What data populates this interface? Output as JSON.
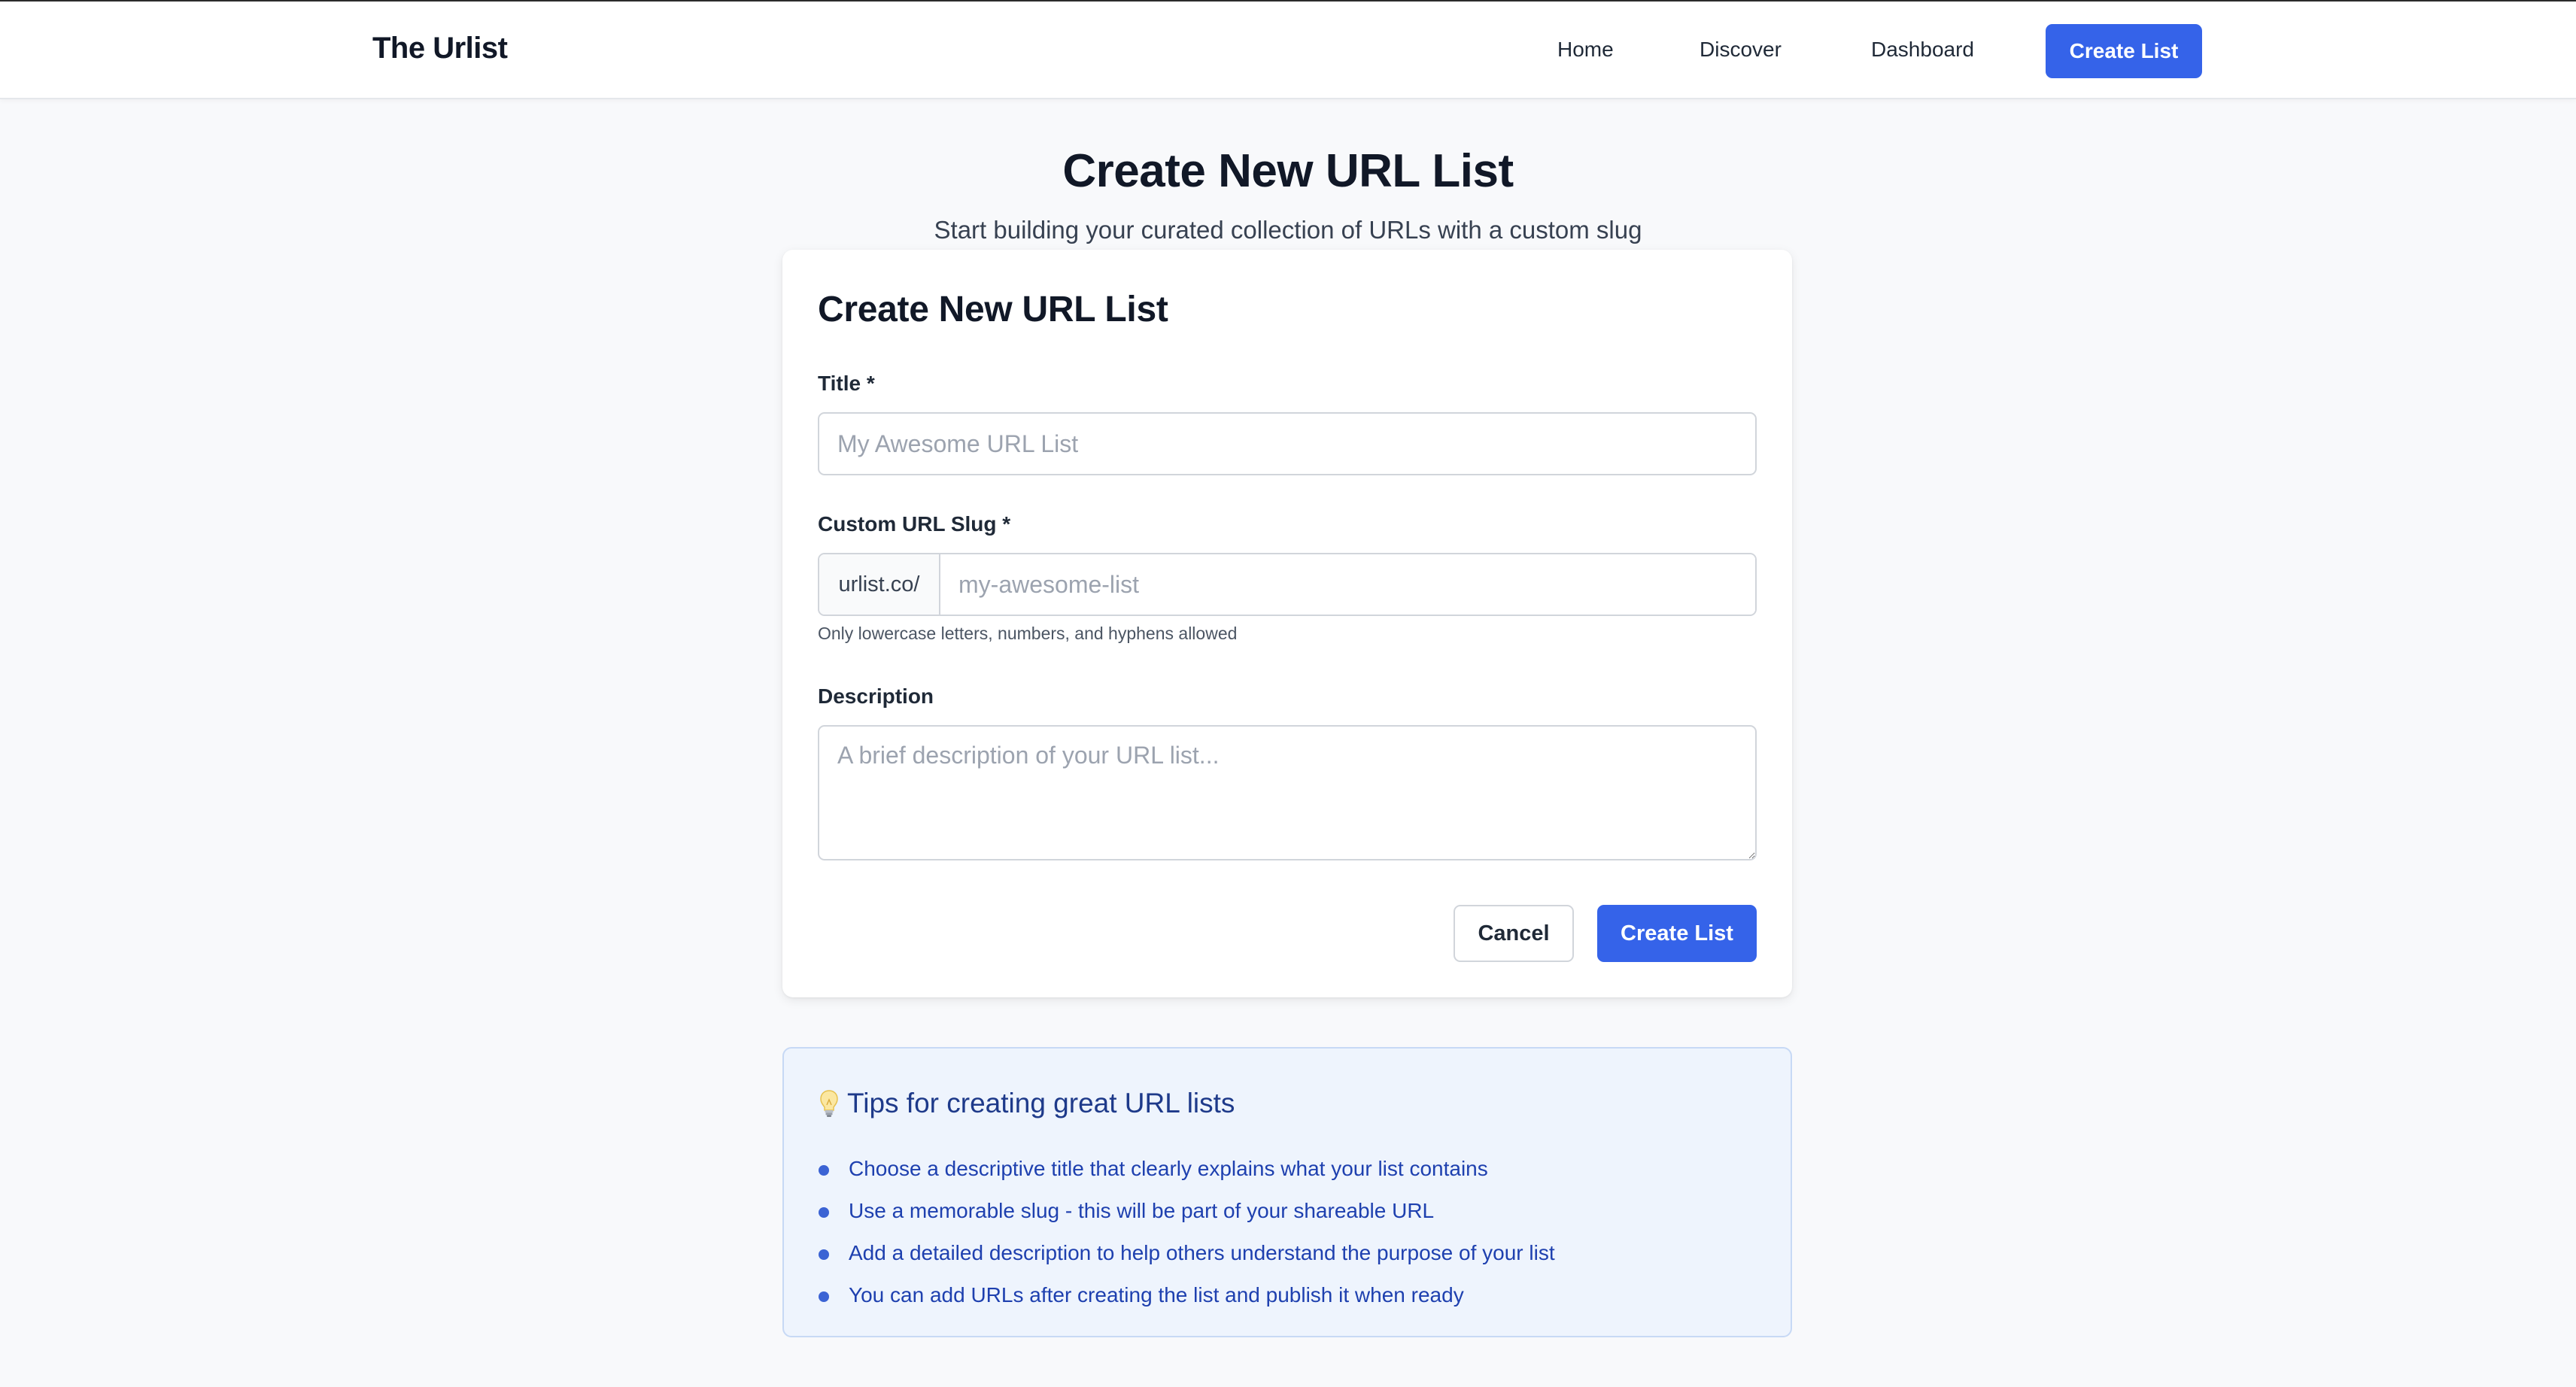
{
  "nav": {
    "brand": "The Urlist",
    "links": [
      {
        "label": "Home"
      },
      {
        "label": "Discover"
      },
      {
        "label": "Dashboard"
      }
    ],
    "cta_label": "Create List"
  },
  "header": {
    "title": "Create New URL List",
    "subtitle": "Start building your curated collection of URLs with a custom slug"
  },
  "form": {
    "title": "Create New URL List",
    "title_field": {
      "label": "Title *",
      "placeholder": "My Awesome URL List",
      "value": ""
    },
    "slug_field": {
      "label": "Custom URL Slug *",
      "prefix": "urlist.co/",
      "placeholder": "my-awesome-list",
      "value": "",
      "helper": "Only lowercase letters, numbers, and hyphens allowed"
    },
    "description_field": {
      "label": "Description",
      "placeholder": "A brief description of your URL list...",
      "value": ""
    },
    "cancel_label": "Cancel",
    "submit_label": "Create List"
  },
  "tips": {
    "icon": "lightbulb-icon",
    "title": "Tips for creating great URL lists",
    "items": [
      "Choose a descriptive title that clearly explains what your list contains",
      "Use a memorable slug - this will be part of your shareable URL",
      "Add a detailed description to help others understand the purpose of your list",
      "You can add URLs after creating the list and publish it when ready"
    ]
  },
  "colors": {
    "accent": "#3563e9",
    "page_bg": "#f8f9fb",
    "tips_bg": "#eef4fd",
    "tips_text": "#1e40af"
  }
}
